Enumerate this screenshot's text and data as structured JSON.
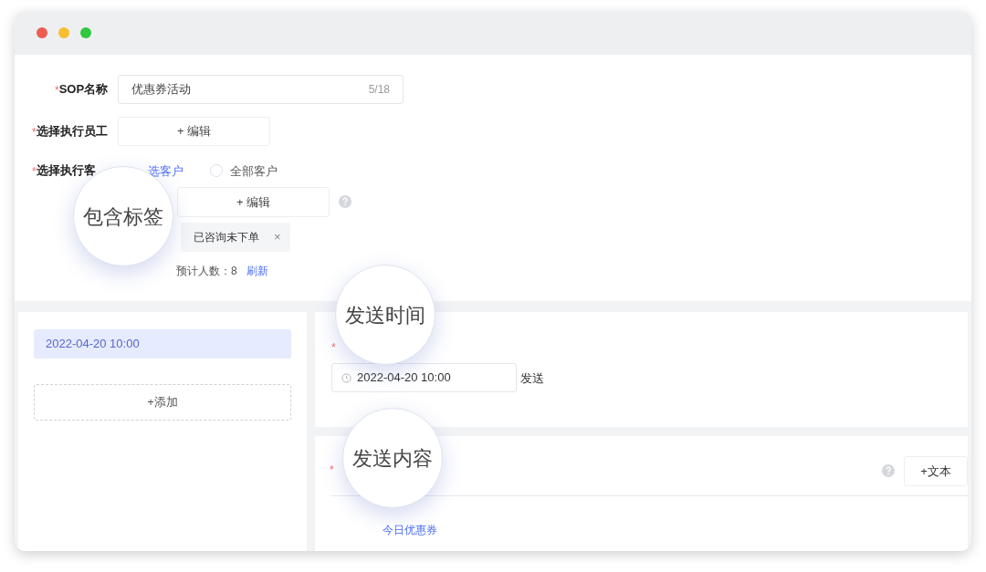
{
  "window": {
    "controls": [
      {
        "color": "#ee5c54"
      },
      {
        "color": "#f7be2f"
      },
      {
        "color": "#2fc840"
      }
    ]
  },
  "form": {
    "name_field": {
      "label": "SOP名称",
      "required_mark": "*",
      "value": "优惠券活动",
      "counter": "5/18"
    },
    "staff": {
      "label": "选择执行员工",
      "required_mark": "*",
      "button": "+ 编辑"
    },
    "customers": {
      "label": "选择执行客",
      "required_mark": "*",
      "options": [
        {
          "label": "选客户",
          "selected": true
        },
        {
          "label": "全部客户",
          "selected": false
        }
      ]
    },
    "tag_editor": {
      "button": "+ 编辑"
    },
    "tags": [
      {
        "label": "已咨询未下单",
        "remove": "×"
      }
    ],
    "estimate": {
      "label": "预计人数：",
      "value": "8",
      "link": "刷新"
    }
  },
  "schedule": {
    "items": [
      {
        "label": "2022-04-20 10:00",
        "selected": true
      }
    ],
    "add_button": "+添加"
  },
  "send_time": {
    "required_mark": "*",
    "value": "2022-04-20 10:00",
    "suffix": "发送"
  },
  "send_content": {
    "required_mark": "*",
    "button": "+文本",
    "item": "今日优惠券"
  },
  "callouts": [
    {
      "text": "包含标签"
    },
    {
      "text": "发送时间"
    },
    {
      "text": "发送内容"
    }
  ]
}
